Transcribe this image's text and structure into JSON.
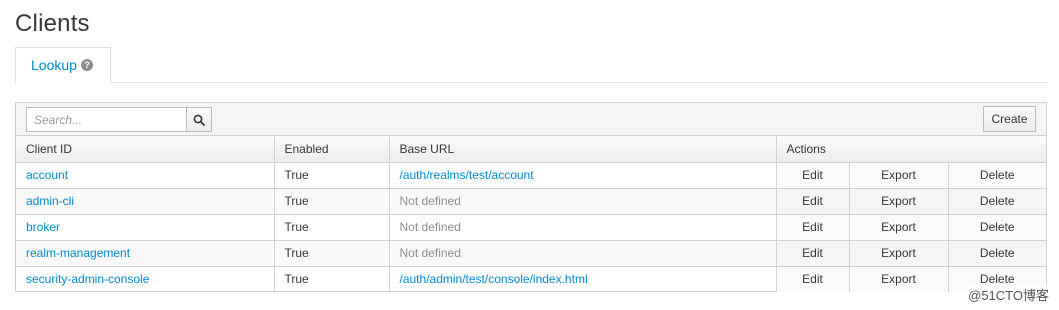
{
  "page": {
    "title": "Clients"
  },
  "tabs": [
    {
      "label": "Lookup",
      "help_icon": "question-circle-icon"
    }
  ],
  "toolbar": {
    "search_placeholder": "Search...",
    "create_label": "Create"
  },
  "table": {
    "columns": [
      "Client ID",
      "Enabled",
      "Base URL",
      "Actions"
    ],
    "rows": [
      {
        "client_id": "account",
        "enabled": "True",
        "base_url": "/auth/realms/test/account",
        "edit": "Edit",
        "export": "Export",
        "delete": "Delete"
      },
      {
        "client_id": "admin-cli",
        "enabled": "True",
        "base_url": "Not defined",
        "edit": "Edit",
        "export": "Export",
        "delete": "Delete"
      },
      {
        "client_id": "broker",
        "enabled": "True",
        "base_url": "Not defined",
        "edit": "Edit",
        "export": "Export",
        "delete": "Delete"
      },
      {
        "client_id": "realm-management",
        "enabled": "True",
        "base_url": "Not defined",
        "edit": "Edit",
        "export": "Export",
        "delete": "Delete"
      },
      {
        "client_id": "security-admin-console",
        "enabled": "True",
        "base_url": "/auth/admin/test/console/index.html",
        "edit": "Edit",
        "export": "Export",
        "delete": "Delete"
      }
    ]
  },
  "watermark": "@51CTO博客",
  "colors": {
    "link": "#0088ce",
    "muted": "#8b8d8f",
    "border": "#d1d1d1"
  }
}
